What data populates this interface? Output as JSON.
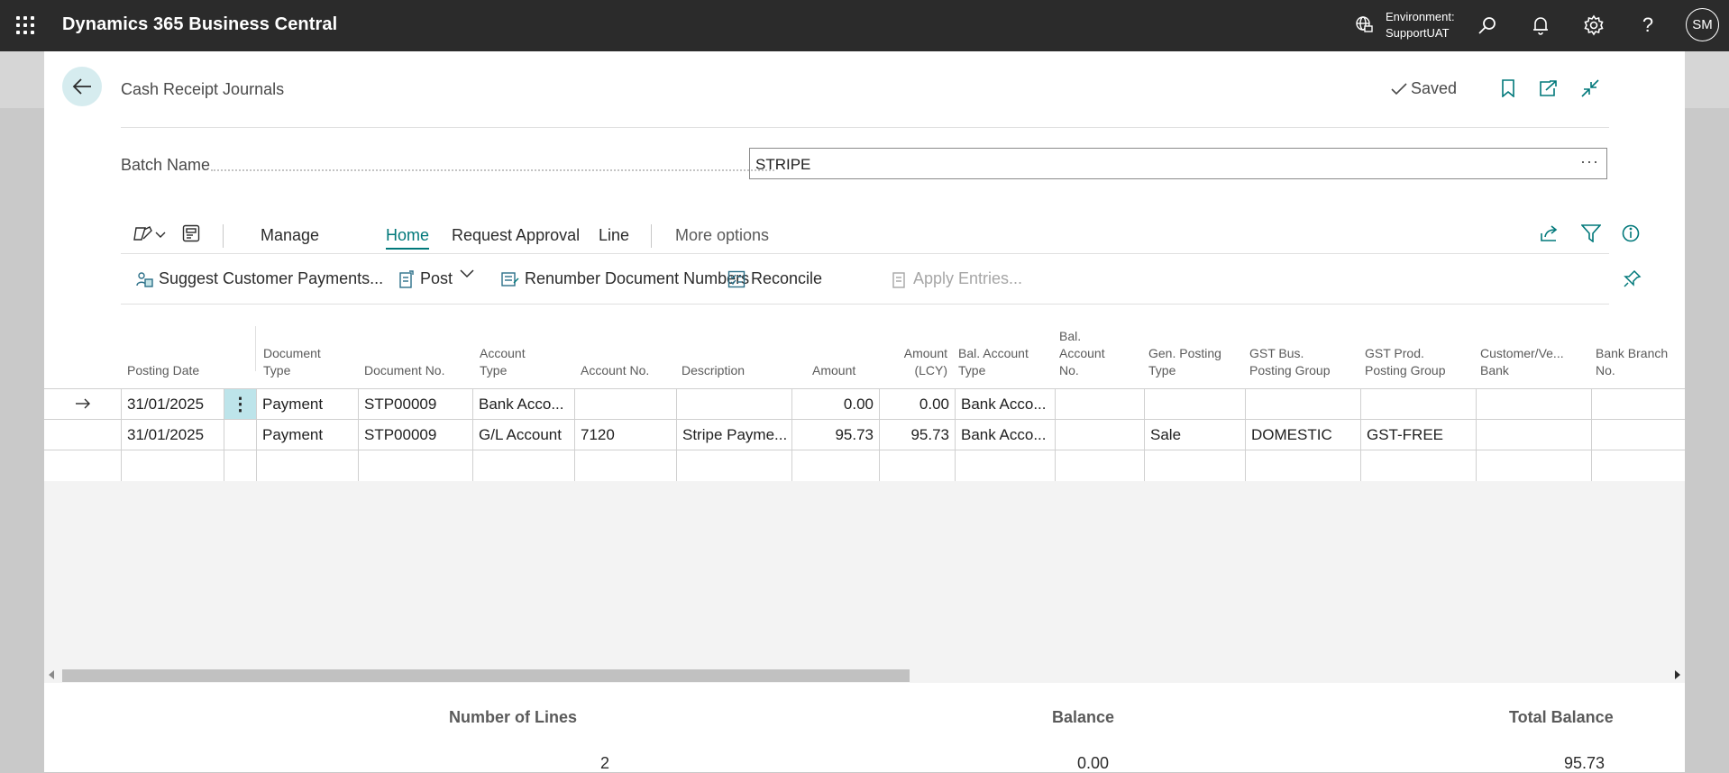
{
  "topbar": {
    "app_title": "Dynamics 365 Business Central",
    "env_label": "Environment:",
    "env_name": "SupportUAT",
    "avatar": "SM",
    "help": "?"
  },
  "page": {
    "title": "Cash Receipt Journals",
    "saved": "Saved",
    "batch_label": "Batch Name",
    "batch_value": "STRIPE"
  },
  "actions": {
    "tabs": [
      "Manage",
      "Home",
      "Request Approval",
      "Line"
    ],
    "more": "More options",
    "row2": [
      "Suggest Customer Payments...",
      "Post",
      "Renumber Document Numbers",
      "Reconcile",
      "Apply Entries..."
    ]
  },
  "grid": {
    "headers": {
      "posting_date": "Posting Date",
      "doc_type_1": "Document",
      "doc_type_2": "Type",
      "doc_no": "Document No.",
      "acc_type_1": "Account",
      "acc_type_2": "Type",
      "acc_no": "Account No.",
      "desc": "Description",
      "amount": "Amount",
      "amount_lcy_1": "Amount",
      "amount_lcy_2": "(LCY)",
      "bal_type_1": "Bal. Account",
      "bal_type_2": "Type",
      "bal_no_1": "Bal.",
      "bal_no_2": "Account",
      "bal_no_3": "No.",
      "gen_post_1": "Gen. Posting",
      "gen_post_2": "Type",
      "gst_bus_1": "GST Bus.",
      "gst_bus_2": "Posting Group",
      "gst_prod_1": "GST Prod.",
      "gst_prod_2": "Posting Group",
      "cust_bank_1": "Customer/Ve...",
      "cust_bank_2": "Bank",
      "bank_branch_1": "Bank Branch",
      "bank_branch_2": "No."
    },
    "rows": [
      {
        "date": "31/01/2025",
        "doc_type": "Payment",
        "doc_no": "STP00009",
        "acc_type": "Bank Acco...",
        "acc_no": "",
        "desc": "",
        "amount": "0.00",
        "amount_lcy": "0.00",
        "bal_type": "Bank Acco...",
        "bal_no": "",
        "gen_post": "",
        "gst_bus": "",
        "gst_prod": ""
      },
      {
        "date": "31/01/2025",
        "doc_type": "Payment",
        "doc_no": "STP00009",
        "acc_type": "G/L Account",
        "acc_no": "7120",
        "desc": "Stripe Payme...",
        "amount": "95.73",
        "amount_lcy": "95.73",
        "bal_type": "Bank Acco...",
        "bal_no": "",
        "gen_post": "Sale",
        "gst_bus": "DOMESTIC",
        "gst_prod": "GST-FREE"
      }
    ]
  },
  "footer": {
    "lines_label": "Number of Lines",
    "lines_value": "2",
    "balance_label": "Balance",
    "balance_value": "0.00",
    "total_label": "Total Balance",
    "total_value": "95.73"
  },
  "colors": {
    "accent": "#00787a",
    "topbar": "#2b2b2b"
  }
}
